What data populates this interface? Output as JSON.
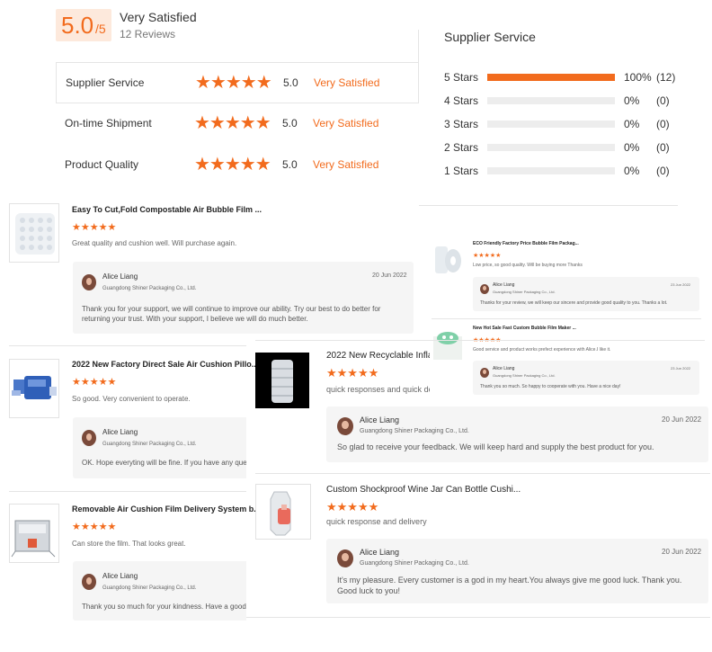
{
  "summary": {
    "score": "5.0",
    "score_suffix": "/5",
    "title": "Very Satisfied",
    "count": "12 Reviews"
  },
  "ratings": [
    {
      "label": "Supplier Service",
      "value": "5.0",
      "word": "Very Satisfied",
      "stars": "★★★★★"
    },
    {
      "label": "On-time Shipment",
      "value": "5.0",
      "word": "Very Satisfied",
      "stars": "★★★★★"
    },
    {
      "label": "Product Quality",
      "value": "5.0",
      "word": "Very Satisfied",
      "stars": "★★★★★"
    }
  ],
  "distribution": {
    "title": "Supplier Service",
    "rows": [
      {
        "label": "5 Stars",
        "fraction": 1.0,
        "pct": "100%",
        "count": "(12)"
      },
      {
        "label": "4 Stars",
        "fraction": 0,
        "pct": "0%",
        "count": "(0)"
      },
      {
        "label": "3 Stars",
        "fraction": 0,
        "pct": "0%",
        "count": "(0)"
      },
      {
        "label": "2 Stars",
        "fraction": 0,
        "pct": "0%",
        "count": "(0)"
      },
      {
        "label": "1 Stars",
        "fraction": 0,
        "pct": "0%",
        "count": "(0)"
      }
    ]
  },
  "colors": {
    "accent": "#f26b1d",
    "reply_bg": "#f5f5f5"
  },
  "reviews": [
    {
      "title": "Easy To Cut,Fold Compostable Air Bubble Film ...",
      "stars": "★★★★★",
      "comment": "Great quality and cushion well. Will purchase again.",
      "reply": {
        "name": "Alice Liang",
        "company": "Guangdong Shiner Packaging Co., Ltd.",
        "date": "20 Jun 2022",
        "text": "Thank you for your support, we will continue to improve our ability. Try our best to do better for returning your trust. With your support, I believe we will do much better."
      },
      "thumb_icon": "bubble-film-roll-icon"
    },
    {
      "title": "ECO Friendly Factory Price Bubble Film Packag...",
      "stars": "★★★★★",
      "comment": "Low price, so good quality. Will be buying more Thanks",
      "reply": {
        "name": "Alice Liang",
        "company": "Guangdong Shiner Packaging Co., Ltd.",
        "date": "23 Jun 2022",
        "text": "Thanks for your review, we will keep our sincere and provide good quality to you. Thanks a lot."
      },
      "thumb_icon": "film-roll-icon"
    },
    {
      "title": "New Hot Sale Fast Custom Bubble Film Maker ...",
      "stars": "★★★★★",
      "comment": "Good service and product works prefect experience with Alice.I like it.",
      "reply": {
        "name": "Alice Liang",
        "company": "Guangdong Shiner Packaging Co., Ltd.",
        "date": "23 Jun 2022",
        "text": "Thank you so much. So happy to cooperate with you. Have a nice day!"
      },
      "thumb_icon": "green-bubble-icon"
    },
    {
      "title": "2022 New Factory Direct Sale Air Cushion Pillo...",
      "stars": "★★★★★",
      "comment": "So good. Very convenient to operate.",
      "reply": {
        "name": "Alice Liang",
        "company": "Guangdong Shiner Packaging Co., Ltd.",
        "date": "",
        "text": "OK. Hope everyting will be fine. If you have any questio"
      },
      "thumb_icon": "air-cushion-machine-icon"
    },
    {
      "title": "2022 New Recyclable Infla",
      "stars": "★★★★★",
      "comment": "quick responses and quick deli",
      "reply": {
        "name": "Alice Liang",
        "company": "Guangdong Shiner Packaging Co., Ltd.",
        "date": "20 Jun 2022",
        "text": "So glad to receive your feedback. We will keep hard and supply the best product for you."
      },
      "thumb_icon": "inflatable-column-bag-icon"
    },
    {
      "title": "Removable Air Cushion Film Delivery System b...",
      "stars": "★★★★★",
      "comment": "Can store the film. That looks great.",
      "reply": {
        "name": "Alice Liang",
        "company": "Guangdong Shiner Packaging Co., Ltd.",
        "date": "",
        "text": "Thank you so much for your kindness. Have a good day"
      },
      "thumb_icon": "film-delivery-system-icon"
    },
    {
      "title": "Custom Shockproof Wine Jar Can Bottle Cushi...",
      "stars": "★★★★★",
      "comment": "quick response and delivery",
      "reply": {
        "name": "Alice Liang",
        "company": "Guangdong Shiner Packaging Co., Ltd.",
        "date": "20 Jun 2022",
        "text": "It's my pleasure. Every customer is a god in my heart.You always give me good luck. Thank you. Good luck to you!"
      },
      "thumb_icon": "wine-bottle-cushion-icon"
    }
  ]
}
